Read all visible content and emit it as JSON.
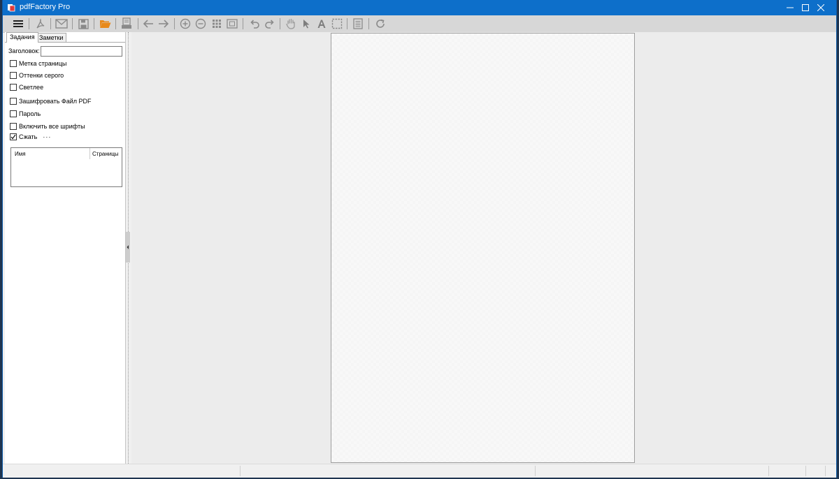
{
  "window": {
    "title": "pdfFactory Pro",
    "accent_color": "#0d6fca",
    "controls": [
      "minimize-icon",
      "maximize-icon",
      "close-icon"
    ]
  },
  "toolbar": {
    "icons": [
      "menu-icon",
      "pdf-icon",
      "email-icon",
      "save-icon",
      "open-folder-icon",
      "print-icon",
      "back-arrow-icon",
      "forward-arrow-icon",
      "zoom-in-icon",
      "zoom-out-icon",
      "thumbnails-icon",
      "fit-page-icon",
      "undo-icon",
      "redo-icon",
      "hand-tool-icon",
      "pointer-icon",
      "text-tool-icon",
      "select-area-icon",
      "document-icon",
      "refresh-icon"
    ],
    "open_folder_color": "#e8891a"
  },
  "panel": {
    "tabs": [
      {
        "label": "Задания",
        "active": true
      },
      {
        "label": "Заметки",
        "active": false
      }
    ],
    "title_label": "Заголовок:",
    "title_value": "",
    "options": [
      {
        "label": "Метка страницы",
        "checked": false
      },
      {
        "label": "Оттенки серого",
        "checked": false
      },
      {
        "label": "Светлее",
        "checked": false
      },
      {
        "label": "Зашифровать Файл PDF",
        "checked": false
      },
      {
        "label": "Пароль",
        "checked": false
      },
      {
        "label": "Включить все шрифты",
        "checked": false
      },
      {
        "label": "Сжать",
        "checked": true
      }
    ],
    "more_label": "···",
    "list_columns": [
      "Имя",
      "Страницы"
    ],
    "list_rows": []
  }
}
